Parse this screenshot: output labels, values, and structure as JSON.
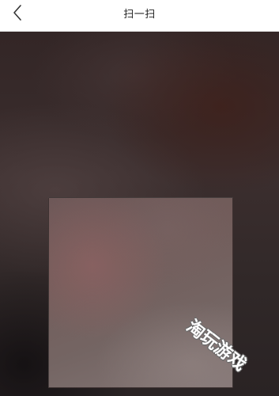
{
  "header": {
    "title": "扫一扫",
    "back_icon": "chevron-left-icon"
  },
  "watermark": {
    "text": "淘玩游戏"
  }
}
